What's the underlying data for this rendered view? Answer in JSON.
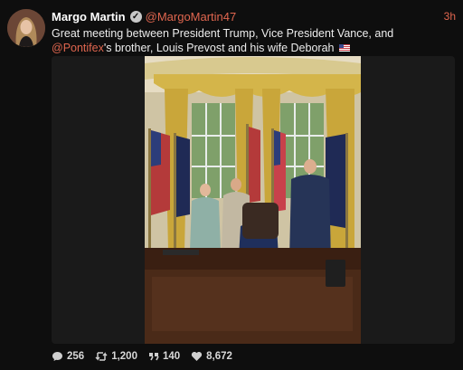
{
  "post": {
    "author_name": "Margo Martin",
    "verified_mark": "✓",
    "handle": "@MargoMartin47",
    "time": "3h",
    "text_before_mention": "Great meeting between President Trump, Vice President Vance, and ",
    "mention": "@Pontifex",
    "text_after_mention": "'s brother, Louis Prevost and his wife Deborah",
    "flag": "us-flag"
  },
  "actions": {
    "replies": "256",
    "reposts": "1,200",
    "quotes": "140",
    "likes": "8,672"
  },
  "icons": {
    "verified": "verified-icon",
    "reply": "comment-icon",
    "repost": "repost-icon",
    "quote": "quote-icon",
    "like": "heart-icon"
  },
  "colors": {
    "accent": "#e0664f",
    "background": "#0e0e0e",
    "text": "#ececec"
  }
}
